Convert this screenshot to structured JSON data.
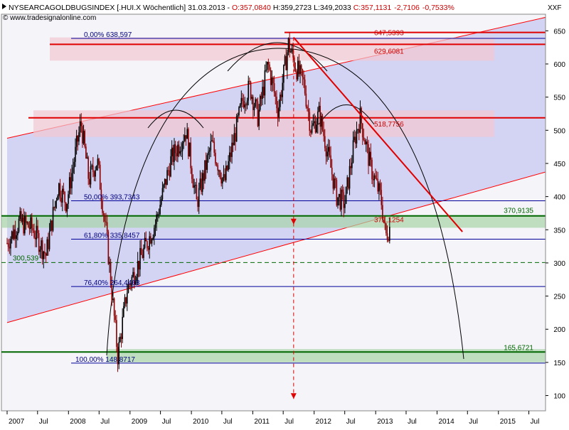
{
  "header": {
    "symbol_line": "NYSEARCAGOLDBUGSINDEX [.HUI.X  Wöchentlich] 31.03.2013 - ",
    "open": "O:357,0840",
    "high": "H:359,2723",
    "low": "L:349,2033",
    "close": "C:357,1131",
    "change": "-2,7106",
    "change_pct": "-0,7533%",
    "watermark": "© www.tradesignalonline.com",
    "corner_label": "XXF"
  },
  "colors": {
    "background": "#ffffff",
    "plot_background": "#f4f4f9",
    "channel_fill": "#c8c8f0",
    "channel_line": "#ff0000",
    "fib_line": "#000099",
    "fib_text": "#000080",
    "resistance_fill": "#f2c8d2",
    "resistance_line": "#e00000",
    "support_fill": "#a8d4a8",
    "support_line": "#006600",
    "trend_line": "#e00000",
    "arc_line": "#000000",
    "candle_up": "#000000",
    "candle_down": "#8b0000",
    "label_red": "#cc0000",
    "label_green": "#006600"
  },
  "chart_data": {
    "type": "candlestick",
    "title": "NYSEARCAGOLDBUGSINDEX [.HUI.X  Wöchentlich]",
    "y_axis": {
      "position": "right",
      "ylim": [
        77,
        675
      ],
      "ticks": [
        100,
        150,
        200,
        250,
        300,
        350,
        400,
        450,
        500,
        550,
        600,
        650
      ]
    },
    "x_axis": {
      "range": [
        "2007-01-01",
        "2015-12-31"
      ],
      "ticks": [
        {
          "label": "2007",
          "date": "2007-01-01"
        },
        {
          "label": "Jul",
          "date": "2007-07-01"
        },
        {
          "label": "2008",
          "date": "2008-01-01"
        },
        {
          "label": "Jul",
          "date": "2008-07-01"
        },
        {
          "label": "2009",
          "date": "2009-01-01"
        },
        {
          "label": "Jul",
          "date": "2009-07-01"
        },
        {
          "label": "2010",
          "date": "2010-01-01"
        },
        {
          "label": "Jul",
          "date": "2010-07-01"
        },
        {
          "label": "2011",
          "date": "2011-01-01"
        },
        {
          "label": "Jul",
          "date": "2011-07-01"
        },
        {
          "label": "2012",
          "date": "2012-01-01"
        },
        {
          "label": "Jul",
          "date": "2012-07-01"
        },
        {
          "label": "2013",
          "date": "2013-01-01"
        },
        {
          "label": "Jul",
          "date": "2013-07-01"
        },
        {
          "label": "2014",
          "date": "2014-01-01"
        },
        {
          "label": "Jul",
          "date": "2014-07-01"
        },
        {
          "label": "2015",
          "date": "2015-01-01"
        },
        {
          "label": "Jul",
          "date": "2015-07-01"
        }
      ]
    },
    "price_path": [
      {
        "date": "2007-01-01",
        "value": 330
      },
      {
        "date": "2007-03-15",
        "value": 362
      },
      {
        "date": "2007-06-01",
        "value": 352
      },
      {
        "date": "2007-08-20",
        "value": 312
      },
      {
        "date": "2007-11-01",
        "value": 418
      },
      {
        "date": "2007-12-20",
        "value": 390
      },
      {
        "date": "2008-03-15",
        "value": 512
      },
      {
        "date": "2008-05-01",
        "value": 425
      },
      {
        "date": "2008-06-20",
        "value": 455
      },
      {
        "date": "2008-08-15",
        "value": 340
      },
      {
        "date": "2008-10-20",
        "value": 160
      },
      {
        "date": "2008-12-15",
        "value": 260
      },
      {
        "date": "2009-03-01",
        "value": 305
      },
      {
        "date": "2009-06-01",
        "value": 360
      },
      {
        "date": "2009-09-01",
        "value": 455
      },
      {
        "date": "2009-12-01",
        "value": 500
      },
      {
        "date": "2010-02-01",
        "value": 390
      },
      {
        "date": "2010-05-01",
        "value": 480
      },
      {
        "date": "2010-07-15",
        "value": 420
      },
      {
        "date": "2010-11-01",
        "value": 545
      },
      {
        "date": "2010-12-15",
        "value": 565
      },
      {
        "date": "2011-02-01",
        "value": 520
      },
      {
        "date": "2011-04-01",
        "value": 600
      },
      {
        "date": "2011-06-01",
        "value": 530
      },
      {
        "date": "2011-08-01",
        "value": 630
      },
      {
        "date": "2011-09-15",
        "value": 595
      },
      {
        "date": "2011-11-01",
        "value": 570
      },
      {
        "date": "2011-12-15",
        "value": 500
      },
      {
        "date": "2012-02-01",
        "value": 525
      },
      {
        "date": "2012-05-15",
        "value": 400
      },
      {
        "date": "2012-07-01",
        "value": 390
      },
      {
        "date": "2012-09-01",
        "value": 490
      },
      {
        "date": "2012-10-01",
        "value": 520
      },
      {
        "date": "2012-12-01",
        "value": 445
      },
      {
        "date": "2013-02-01",
        "value": 398
      },
      {
        "date": "2013-03-01",
        "value": 340
      },
      {
        "date": "2013-03-31",
        "value": 357
      }
    ],
    "channel": {
      "upper": [
        {
          "date": "2007-01-01",
          "value": 488
        },
        {
          "date": "2015-12-31",
          "value": 675
        }
      ],
      "lower": [
        {
          "date": "2007-01-01",
          "value": 210
        },
        {
          "date": "2015-12-31",
          "value": 443
        }
      ]
    },
    "fibonacci": [
      {
        "label": "0,00%",
        "value": 638.597
      },
      {
        "label": "50,00%",
        "value": 393.7343
      },
      {
        "label": "61,80%",
        "value": 335.8457
      },
      {
        "label": "76,40%",
        "value": 264.4468
      },
      {
        "label": "100,00%",
        "value": 148.8717
      }
    ],
    "fibonacci_value_labels": {
      "0,00%": "638,597",
      "50,00%": "393,7343",
      "61,80%": "335,8457",
      "76,40%": "264,4468",
      "100,00%": "148,8717"
    },
    "horizontal_lines": [
      {
        "value": 629.6081,
        "label": "629,6081",
        "color": "red"
      },
      {
        "value": 647.5393,
        "label": "647,5393",
        "color": "red"
      },
      {
        "value": 518.7756,
        "label": "518,7756",
        "color": "red"
      },
      {
        "value": 370.9135,
        "label": "370,9135",
        "color": "green"
      },
      {
        "value": 165.6721,
        "label": "165,6721",
        "color": "green"
      },
      {
        "value": 300.539,
        "label": "300,539",
        "color": "green",
        "style": "dashed"
      }
    ],
    "last_price_label": {
      "value": 371.1254,
      "label": "371,1254"
    },
    "zones": [
      {
        "name": "resistance",
        "low": 605,
        "high": 640
      },
      {
        "name": "resistance",
        "low": 490,
        "high": 530
      },
      {
        "name": "support",
        "low": 353,
        "high": 372
      },
      {
        "name": "support",
        "low": 150,
        "high": 170
      }
    ],
    "trend_line": [
      {
        "date": "2011-09-01",
        "value": 640
      },
      {
        "date": "2014-06-01",
        "value": 347
      }
    ],
    "projection_arrow": {
      "date": "2011-09-01",
      "from": 640,
      "to": 95
    },
    "legend": null,
    "grid": false
  }
}
